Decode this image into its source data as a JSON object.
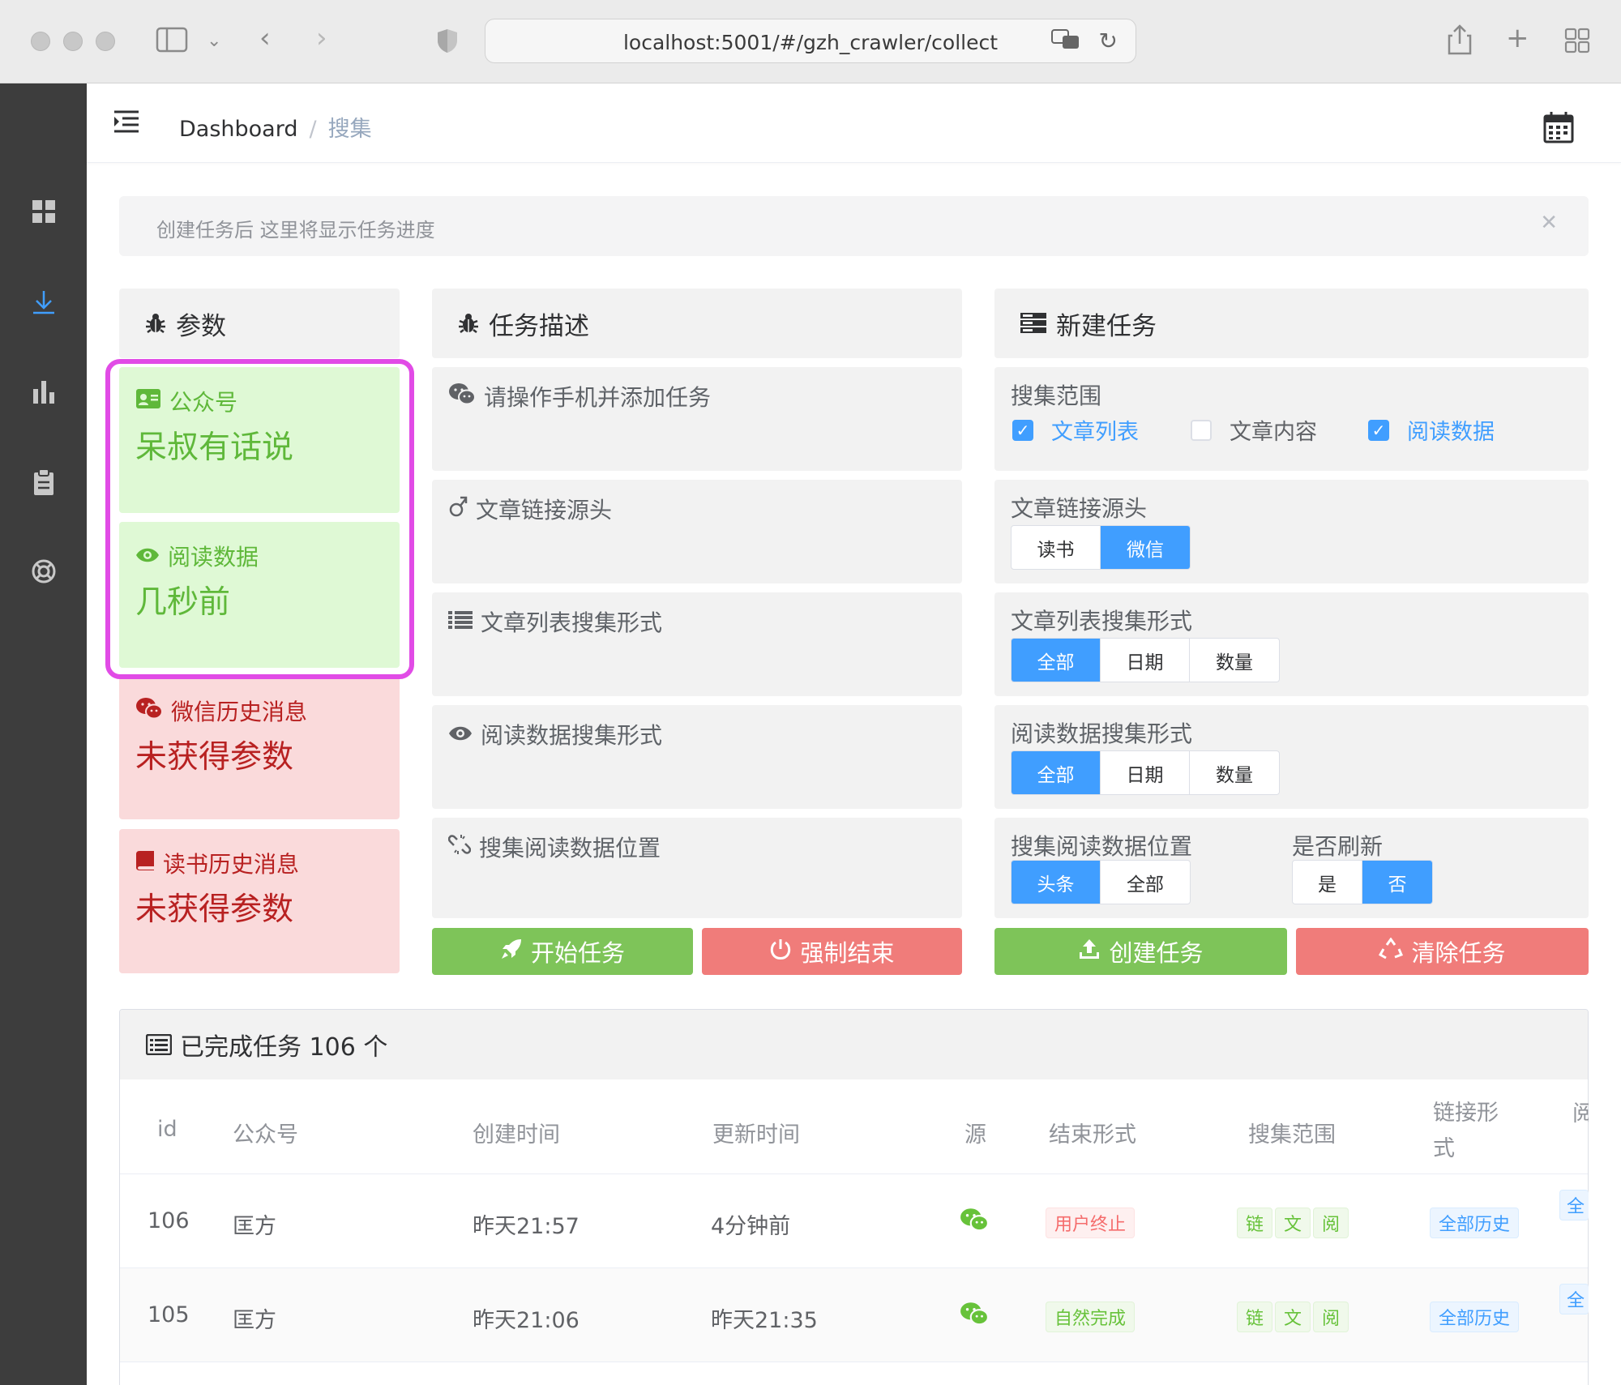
{
  "browser": {
    "url": "localhost:5001/#/gzh_crawler/collect"
  },
  "breadcrumb": {
    "home": "Dashboard",
    "current": "搜集"
  },
  "alert": {
    "text": "创建任务后 这里将显示任务进度"
  },
  "params": {
    "title": "参数",
    "items": [
      {
        "label": "公众号",
        "value": "呆叔有话说",
        "status": "ok"
      },
      {
        "label": "阅读数据",
        "value": "几秒前",
        "status": "ok"
      },
      {
        "label": "微信历史消息",
        "value": "未获得参数",
        "status": "bad"
      },
      {
        "label": "读书历史消息",
        "value": "未获得参数",
        "status": "bad"
      }
    ]
  },
  "task_desc": {
    "title": "任务描述",
    "items": [
      {
        "label": "请操作手机并添加任务"
      },
      {
        "label": "文章链接源头"
      },
      {
        "label": "文章列表搜集形式"
      },
      {
        "label": "阅读数据搜集形式"
      },
      {
        "label": "搜集阅读数据位置"
      }
    ],
    "start_button": "开始任务",
    "stop_button": "强制结束"
  },
  "new_task": {
    "title": "新建任务",
    "scope": {
      "label": "搜集范围",
      "options": [
        {
          "label": "文章列表",
          "checked": true
        },
        {
          "label": "文章内容",
          "checked": false
        },
        {
          "label": "阅读数据",
          "checked": true
        }
      ]
    },
    "link_source": {
      "label": "文章链接源头",
      "options": [
        "读书",
        "微信"
      ],
      "selected": "微信"
    },
    "list_mode": {
      "label": "文章列表搜集形式",
      "options": [
        "全部",
        "日期",
        "数量"
      ],
      "selected": "全部"
    },
    "read_mode": {
      "label": "阅读数据搜集形式",
      "options": [
        "全部",
        "日期",
        "数量"
      ],
      "selected": "全部"
    },
    "read_position": {
      "label": "搜集阅读数据位置",
      "options": [
        "头条",
        "全部"
      ],
      "selected": "头条"
    },
    "refresh": {
      "label": "是否刷新",
      "options": [
        "是",
        "否"
      ],
      "selected": "否"
    },
    "create_button": "创建任务",
    "clear_button": "清除任务"
  },
  "completed": {
    "title": "已完成任务 106 个",
    "columns": [
      "id",
      "公众号",
      "创建时间",
      "更新时间",
      "源",
      "结束形式",
      "搜集范围",
      "链接形式",
      "阅"
    ],
    "rows": [
      {
        "id": "106",
        "account": "匡方",
        "created": "昨天21:57",
        "updated": "4分钟前",
        "end": "用户终止",
        "end_type": "red",
        "scope": [
          "链",
          "文",
          "阅"
        ],
        "link": "全部历史",
        "read": "全"
      },
      {
        "id": "105",
        "account": "匡方",
        "created": "昨天21:06",
        "updated": "昨天21:35",
        "end": "自然完成",
        "end_type": "green",
        "scope": [
          "链",
          "文",
          "阅"
        ],
        "link": "全部历史",
        "read": "全"
      }
    ]
  },
  "colors": {
    "primary": "#409eff",
    "success": "#7ec459",
    "danger": "#f07c7a",
    "highlight": "#e14be6"
  }
}
